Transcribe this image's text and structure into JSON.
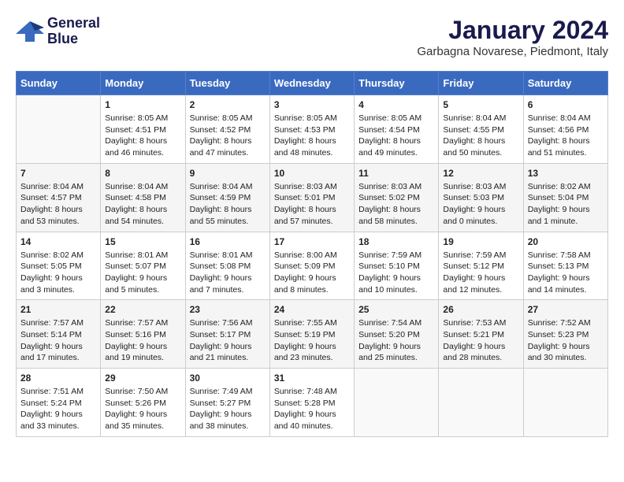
{
  "header": {
    "logo_line1": "General",
    "logo_line2": "Blue",
    "month_title": "January 2024",
    "subtitle": "Garbagna Novarese, Piedmont, Italy"
  },
  "weekdays": [
    "Sunday",
    "Monday",
    "Tuesday",
    "Wednesday",
    "Thursday",
    "Friday",
    "Saturday"
  ],
  "weeks": [
    [
      {
        "day": "",
        "info": ""
      },
      {
        "day": "1",
        "info": "Sunrise: 8:05 AM\nSunset: 4:51 PM\nDaylight: 8 hours\nand 46 minutes."
      },
      {
        "day": "2",
        "info": "Sunrise: 8:05 AM\nSunset: 4:52 PM\nDaylight: 8 hours\nand 47 minutes."
      },
      {
        "day": "3",
        "info": "Sunrise: 8:05 AM\nSunset: 4:53 PM\nDaylight: 8 hours\nand 48 minutes."
      },
      {
        "day": "4",
        "info": "Sunrise: 8:05 AM\nSunset: 4:54 PM\nDaylight: 8 hours\nand 49 minutes."
      },
      {
        "day": "5",
        "info": "Sunrise: 8:04 AM\nSunset: 4:55 PM\nDaylight: 8 hours\nand 50 minutes."
      },
      {
        "day": "6",
        "info": "Sunrise: 8:04 AM\nSunset: 4:56 PM\nDaylight: 8 hours\nand 51 minutes."
      }
    ],
    [
      {
        "day": "7",
        "info": "Sunrise: 8:04 AM\nSunset: 4:57 PM\nDaylight: 8 hours\nand 53 minutes."
      },
      {
        "day": "8",
        "info": "Sunrise: 8:04 AM\nSunset: 4:58 PM\nDaylight: 8 hours\nand 54 minutes."
      },
      {
        "day": "9",
        "info": "Sunrise: 8:04 AM\nSunset: 4:59 PM\nDaylight: 8 hours\nand 55 minutes."
      },
      {
        "day": "10",
        "info": "Sunrise: 8:03 AM\nSunset: 5:01 PM\nDaylight: 8 hours\nand 57 minutes."
      },
      {
        "day": "11",
        "info": "Sunrise: 8:03 AM\nSunset: 5:02 PM\nDaylight: 8 hours\nand 58 minutes."
      },
      {
        "day": "12",
        "info": "Sunrise: 8:03 AM\nSunset: 5:03 PM\nDaylight: 9 hours\nand 0 minutes."
      },
      {
        "day": "13",
        "info": "Sunrise: 8:02 AM\nSunset: 5:04 PM\nDaylight: 9 hours\nand 1 minute."
      }
    ],
    [
      {
        "day": "14",
        "info": "Sunrise: 8:02 AM\nSunset: 5:05 PM\nDaylight: 9 hours\nand 3 minutes."
      },
      {
        "day": "15",
        "info": "Sunrise: 8:01 AM\nSunset: 5:07 PM\nDaylight: 9 hours\nand 5 minutes."
      },
      {
        "day": "16",
        "info": "Sunrise: 8:01 AM\nSunset: 5:08 PM\nDaylight: 9 hours\nand 7 minutes."
      },
      {
        "day": "17",
        "info": "Sunrise: 8:00 AM\nSunset: 5:09 PM\nDaylight: 9 hours\nand 8 minutes."
      },
      {
        "day": "18",
        "info": "Sunrise: 7:59 AM\nSunset: 5:10 PM\nDaylight: 9 hours\nand 10 minutes."
      },
      {
        "day": "19",
        "info": "Sunrise: 7:59 AM\nSunset: 5:12 PM\nDaylight: 9 hours\nand 12 minutes."
      },
      {
        "day": "20",
        "info": "Sunrise: 7:58 AM\nSunset: 5:13 PM\nDaylight: 9 hours\nand 14 minutes."
      }
    ],
    [
      {
        "day": "21",
        "info": "Sunrise: 7:57 AM\nSunset: 5:14 PM\nDaylight: 9 hours\nand 17 minutes."
      },
      {
        "day": "22",
        "info": "Sunrise: 7:57 AM\nSunset: 5:16 PM\nDaylight: 9 hours\nand 19 minutes."
      },
      {
        "day": "23",
        "info": "Sunrise: 7:56 AM\nSunset: 5:17 PM\nDaylight: 9 hours\nand 21 minutes."
      },
      {
        "day": "24",
        "info": "Sunrise: 7:55 AM\nSunset: 5:19 PM\nDaylight: 9 hours\nand 23 minutes."
      },
      {
        "day": "25",
        "info": "Sunrise: 7:54 AM\nSunset: 5:20 PM\nDaylight: 9 hours\nand 25 minutes."
      },
      {
        "day": "26",
        "info": "Sunrise: 7:53 AM\nSunset: 5:21 PM\nDaylight: 9 hours\nand 28 minutes."
      },
      {
        "day": "27",
        "info": "Sunrise: 7:52 AM\nSunset: 5:23 PM\nDaylight: 9 hours\nand 30 minutes."
      }
    ],
    [
      {
        "day": "28",
        "info": "Sunrise: 7:51 AM\nSunset: 5:24 PM\nDaylight: 9 hours\nand 33 minutes."
      },
      {
        "day": "29",
        "info": "Sunrise: 7:50 AM\nSunset: 5:26 PM\nDaylight: 9 hours\nand 35 minutes."
      },
      {
        "day": "30",
        "info": "Sunrise: 7:49 AM\nSunset: 5:27 PM\nDaylight: 9 hours\nand 38 minutes."
      },
      {
        "day": "31",
        "info": "Sunrise: 7:48 AM\nSunset: 5:28 PM\nDaylight: 9 hours\nand 40 minutes."
      },
      {
        "day": "",
        "info": ""
      },
      {
        "day": "",
        "info": ""
      },
      {
        "day": "",
        "info": ""
      }
    ]
  ]
}
